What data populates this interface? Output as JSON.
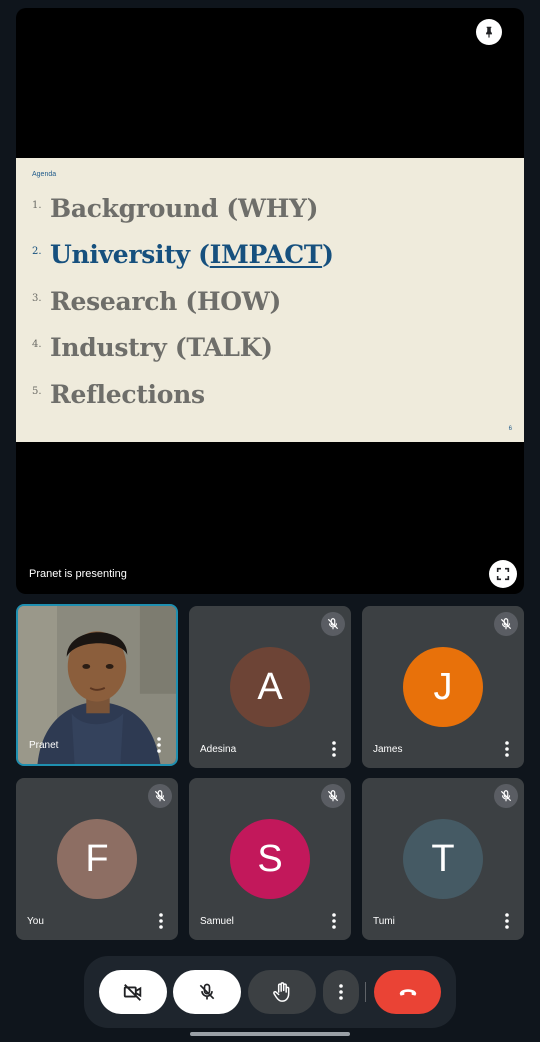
{
  "stage": {
    "presenting_text": "Pranet is presenting"
  },
  "slide": {
    "heading": "Agenda",
    "items": [
      {
        "num": "1.",
        "text": "Background (WHY)"
      },
      {
        "num": "2.",
        "text_prefix": "University (",
        "text_link": "IMPACT",
        "text_suffix": ")"
      },
      {
        "num": "3.",
        "text": "Research (HOW)"
      },
      {
        "num": "4.",
        "text": "Industry (TALK)"
      },
      {
        "num": "5.",
        "text": "Reflections"
      }
    ],
    "page_number": "6",
    "active_color": "#16507e"
  },
  "participants": [
    {
      "name": "Pranet",
      "type": "video"
    },
    {
      "name": "Adesina",
      "initial": "A",
      "color": "#6d4436",
      "muted": true
    },
    {
      "name": "James",
      "initial": "J",
      "color": "#e8710a",
      "muted": true
    },
    {
      "name": "You",
      "initial": "F",
      "color": "#8d6e63",
      "muted": true
    },
    {
      "name": "Samuel",
      "initial": "S",
      "color": "#c2185b",
      "muted": true
    },
    {
      "name": "Tumi",
      "initial": "T",
      "color": "#455a64",
      "muted": true
    }
  ],
  "controls": {
    "camera": "camera-off-icon",
    "mic": "mic-off-icon",
    "hand": "raise-hand-icon",
    "more": "more-vert-icon",
    "end": "end-call-icon",
    "end_color": "#ea4335"
  }
}
